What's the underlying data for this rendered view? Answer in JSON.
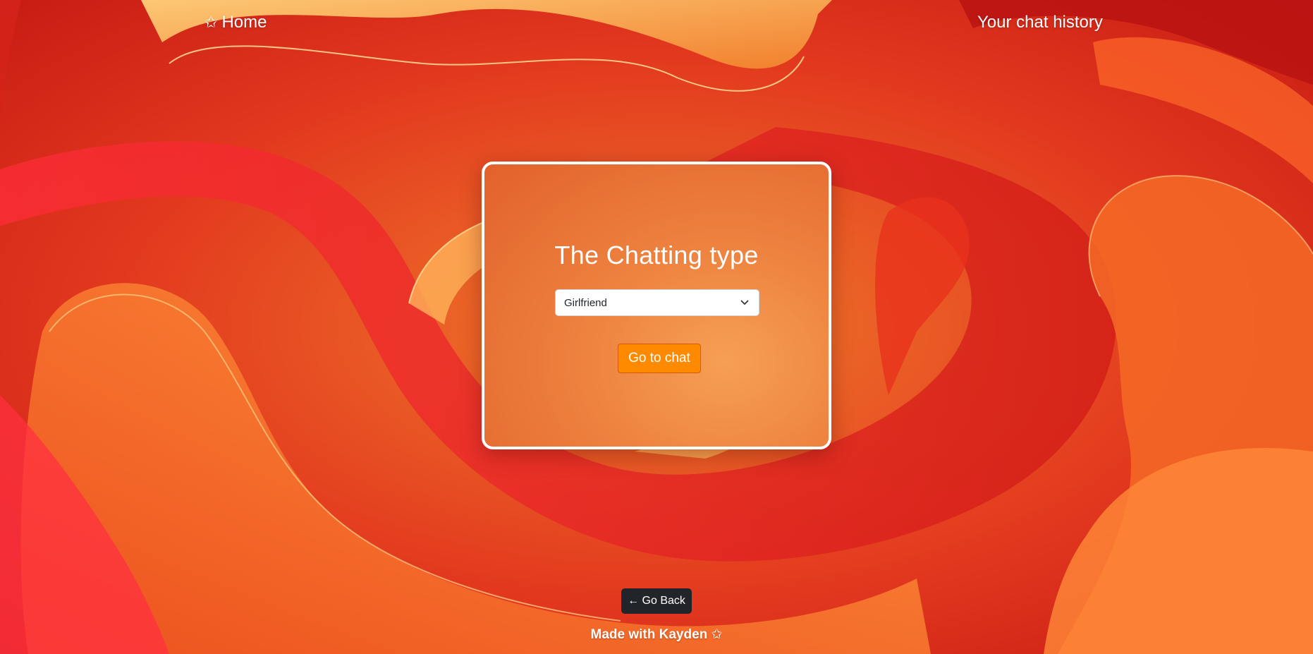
{
  "nav": {
    "home_icon": "star-outline-icon",
    "home_star": "✩",
    "home_label": "Home",
    "history_label": "Your chat history"
  },
  "card": {
    "title": "The Chatting type",
    "select": {
      "selected_value": "Girlfriend",
      "icon": "chevron-down-icon"
    },
    "go_button_label": "Go to chat"
  },
  "back_button_label": "← Go Back",
  "footer": {
    "text": "Made with Kayden ✩"
  },
  "colors": {
    "accent_button": "#ff8a00",
    "back_button": "#212529",
    "background_red": "#e0321c",
    "background_orange": "#f59a3d"
  }
}
